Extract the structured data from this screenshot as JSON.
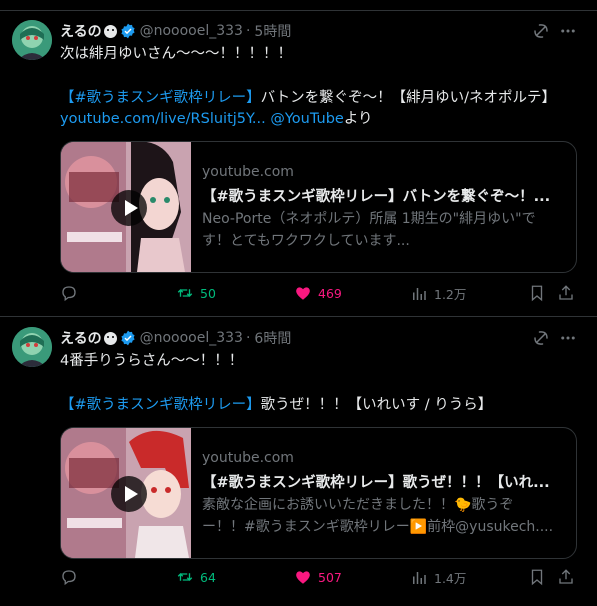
{
  "tweets": [
    {
      "author": "えるの",
      "handle": "@nooooel_333",
      "separator": "·",
      "time": "5時間",
      "line1": "次は緋月ゆいさん～～～！！！！！",
      "line2_tag": "【#歌うまスンギ歌枠リレー】",
      "line2_rest": "バトンを繋ぐぞ～！【緋月ゆい/ネオポルテ】",
      "line3_link": "youtube.com/live/RSluitj5Y...",
      "line3_mention": "@YouTube",
      "line3_suffix": "より",
      "card": {
        "domain": "youtube.com",
        "title": "【#歌うまスンギ歌枠リレー】バトンを繋ぐぞ～！...",
        "desc_line1": "Neo-Porte（ネオポルテ）所属 1期生の\"緋月ゆい\"で",
        "desc_line2": "す！とてもワクワクしています..."
      },
      "stats": {
        "replies": "",
        "retweets": "50",
        "likes": "469",
        "views": "1.2万"
      }
    },
    {
      "author": "えるの",
      "handle": "@nooooel_333",
      "separator": "·",
      "time": "6時間",
      "line1": "4番手りうらさん～～！！！",
      "line2_tag": "【#歌うまスンギ歌枠リレー】",
      "line2_rest": "歌うぜ！！！【いれいす / りうら】",
      "card": {
        "domain": "youtube.com",
        "title": "【#歌うまスンギ歌枠リレー】歌うぜ！！！【いれ...",
        "desc_line1": "素敵な企画にお誘いいただきました！！🐤歌うぞ",
        "desc_line2": "ー！！#歌うまスンギ歌枠リレー▶️前枠@yusukech...."
      },
      "stats": {
        "replies": "",
        "retweets": "64",
        "likes": "507",
        "views": "1.4万"
      }
    }
  ],
  "icons": [
    "avatar",
    "verified-badge-icon",
    "grok-icon",
    "more-icon",
    "play-icon",
    "reply-icon",
    "retweet-icon",
    "like-icon",
    "views-icon",
    "bookmark-icon",
    "share-icon"
  ],
  "colors": {
    "background": "#000000",
    "link": "#1d9bf0",
    "retweet": "#00ba7c",
    "like": "#f91880",
    "muted": "#71767b",
    "verified": "#1d9bf0"
  }
}
